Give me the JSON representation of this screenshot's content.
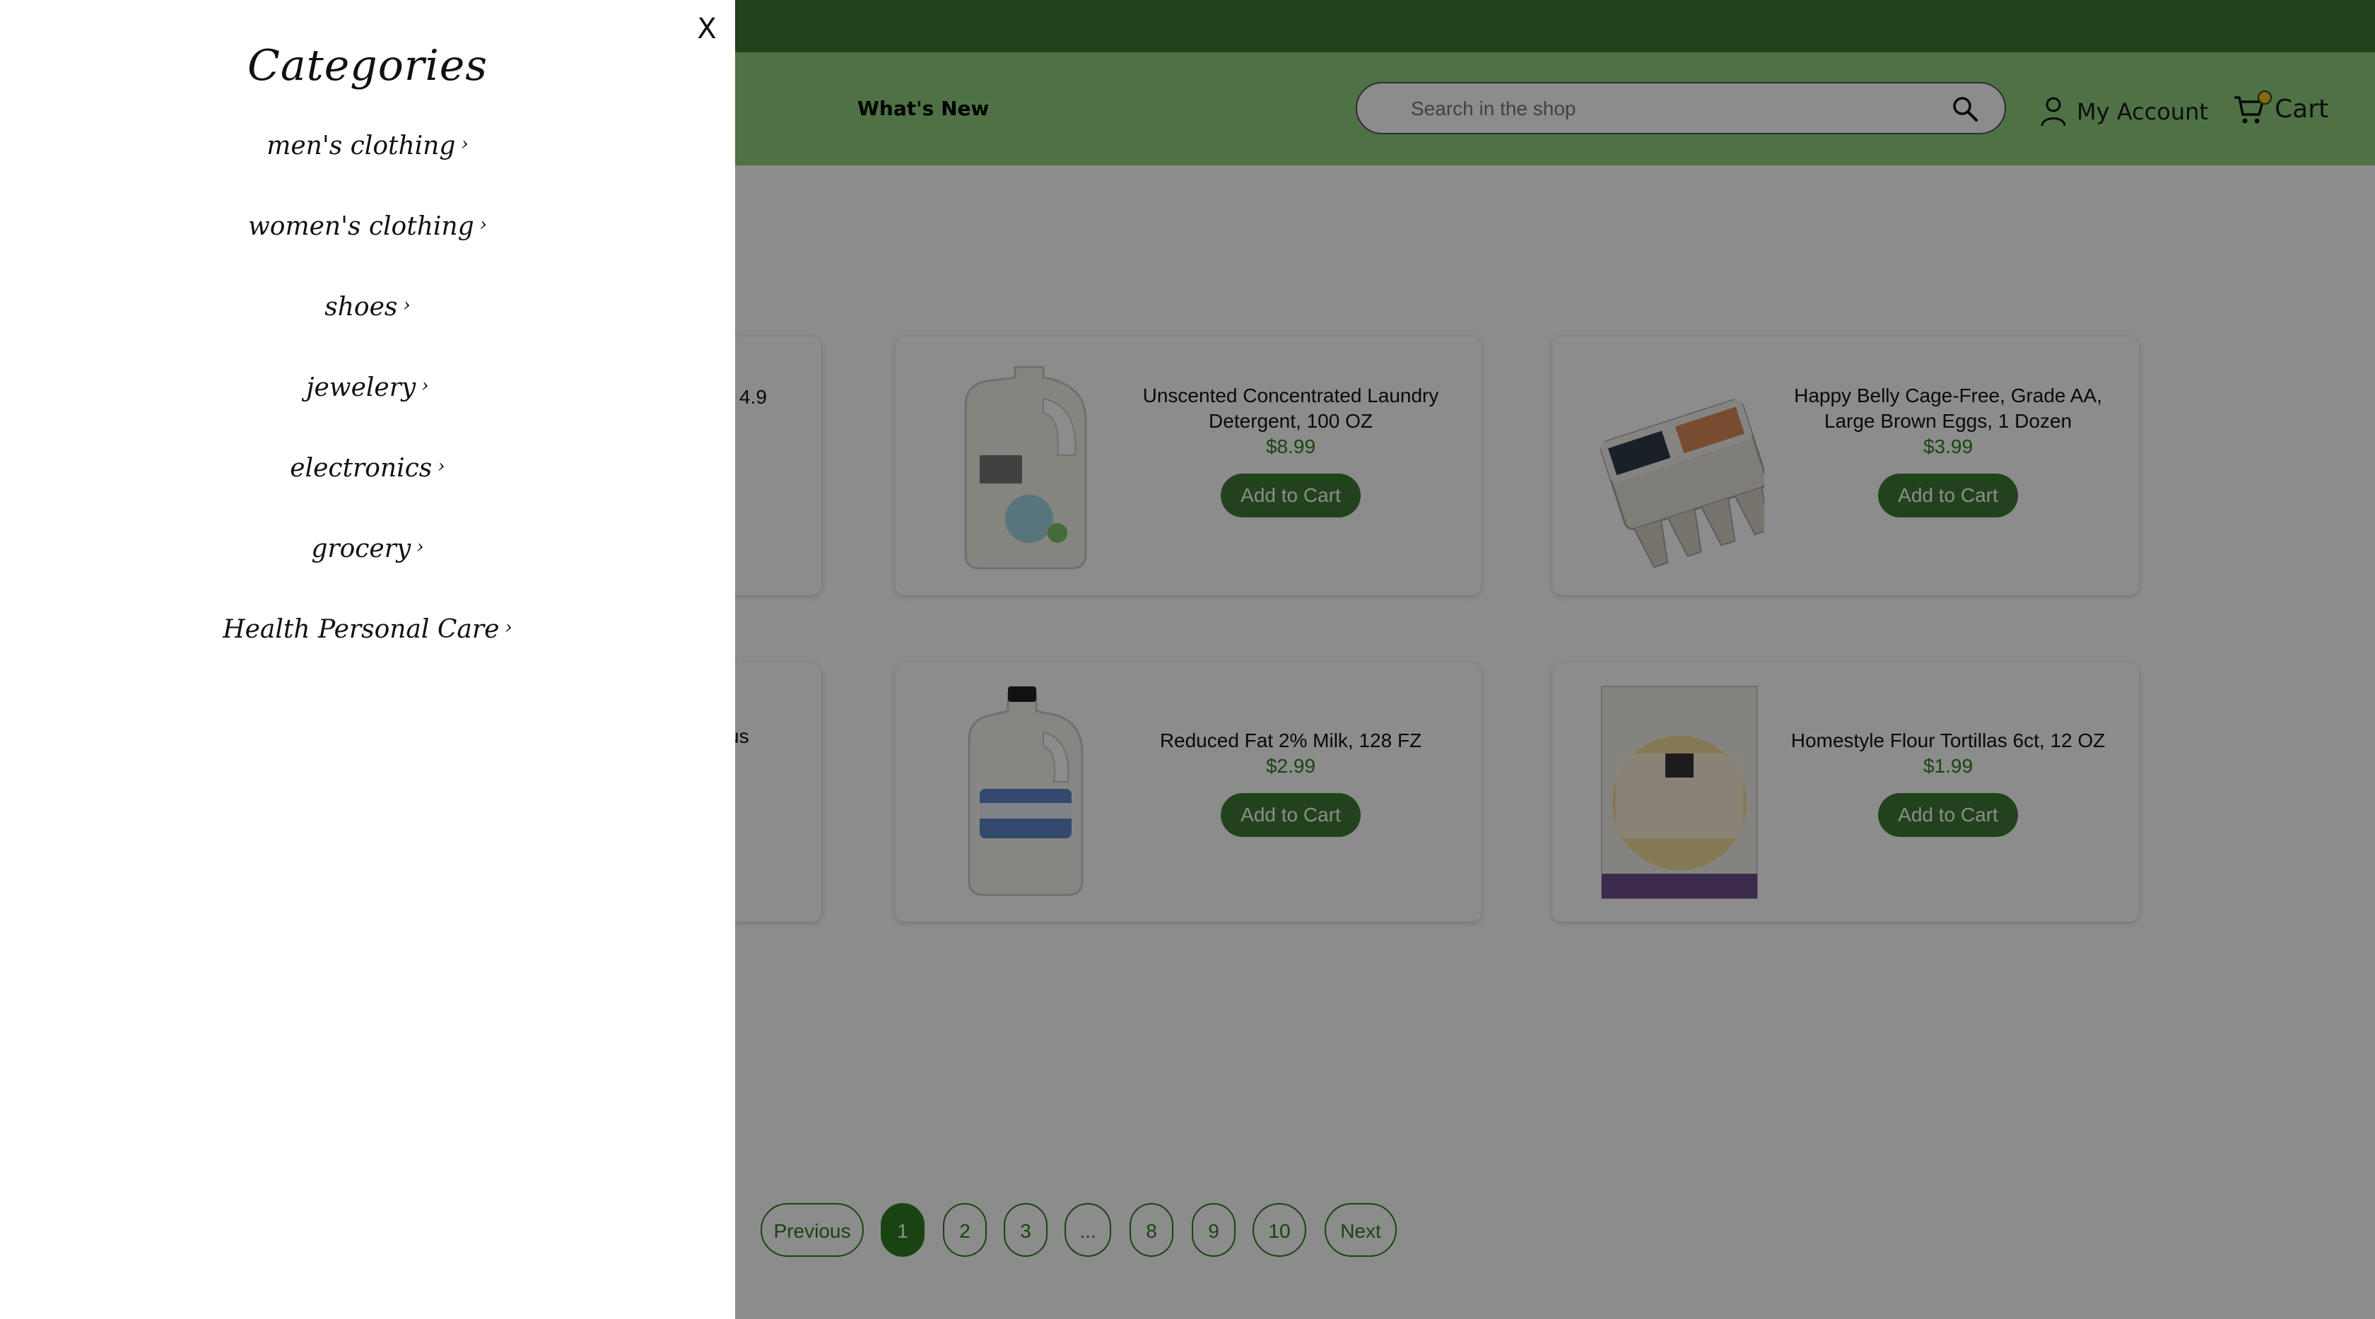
{
  "header": {
    "nav_link": "What's New",
    "search_placeholder": "Search in the shop",
    "account_label": "My Account",
    "cart_label": "Cart",
    "cart_count": ""
  },
  "products": [
    {
      "title": "Unscented Concentrated Laundry Detergent, 100 OZ",
      "price": "$8.99",
      "button": "Add to Cart"
    },
    {
      "title": "Happy Belly Cage-Free, Grade AA, Large Brown Eggs, 1 Dozen",
      "price": "$3.99",
      "button": "Add to Cart"
    },
    {
      "title": "Reduced Fat 2% Milk, 128 FZ",
      "price": "$2.99",
      "button": "Add to Cart"
    },
    {
      "title": "Homestyle Flour Tortillas 6ct, 12 OZ",
      "price": "$1.99",
      "button": "Add to Cart"
    }
  ],
  "partial_texts": [
    "4.9",
    "us"
  ],
  "pagination": {
    "previous": "Previous",
    "pages": [
      "1",
      "2",
      "3",
      "...",
      "8",
      "9",
      "10"
    ],
    "next": "Next",
    "active": "1"
  },
  "drawer": {
    "close": "X",
    "title": "Categories",
    "categories": [
      "men's clothing",
      "women's clothing",
      "shoes",
      "jewelery",
      "electronics",
      "grocery",
      "Health Personal Care"
    ],
    "chevron": "›"
  },
  "colors": {
    "topbar": "#3d7a32",
    "header": "#8fd07f",
    "accent_green": "#2f7d1f",
    "button_green": "#3d7a32"
  }
}
